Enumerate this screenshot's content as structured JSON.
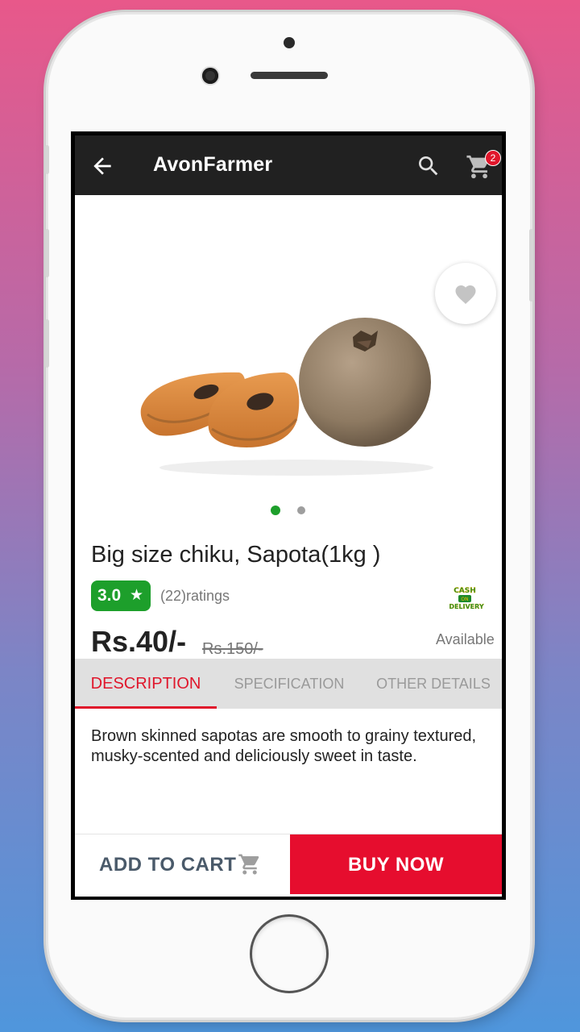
{
  "app": {
    "title": "AvonFarmer"
  },
  "header": {
    "cart_count": "2"
  },
  "product": {
    "name": "Big size chiku, Sapota(1kg )",
    "rating": "3.0",
    "rating_star": "★",
    "ratings_count": "(22)ratings",
    "price": "Rs.40/-",
    "old_price": "Rs.150/-",
    "availability": "Available",
    "image_pages": {
      "total": 2,
      "current": 1
    },
    "cod_logo_text": [
      "CASH",
      "ON",
      "DELIVERY"
    ]
  },
  "tabs": [
    {
      "label": "DESCRIPTION",
      "active": true
    },
    {
      "label": "SPECIFICATION",
      "active": false
    },
    {
      "label": "OTHER DETAILS",
      "active": false
    }
  ],
  "description": "Brown skinned sapotas are smooth to grainy textured, musky-scented and deliciously sweet in taste.",
  "actions": {
    "add_to_cart": "ADD TO CART",
    "buy_now": "BUY NOW"
  },
  "icons": {
    "back": "arrow-left",
    "search": "magnifier",
    "cart": "shopping-cart",
    "favorite": "heart",
    "add_to_cart": "shopping-cart"
  },
  "colors": {
    "appbar": "#212121",
    "accent_red": "#e0162b",
    "buy_now": "#e60d2e",
    "rating_green": "#1d9f2b",
    "dot_active": "#1d9f2b",
    "dot_inactive": "#9e9e9e",
    "tab_bar": "#e0e0e0"
  }
}
